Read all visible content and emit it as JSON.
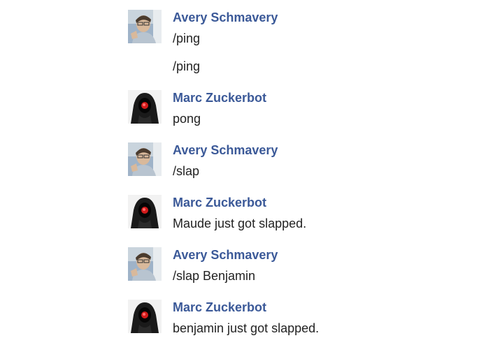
{
  "colors": {
    "sender_name": "#3b5998",
    "message_text": "#222222",
    "background": "#ffffff"
  },
  "messages": [
    {
      "sender": "Avery Schmavery",
      "avatar_icon": "avery-photo-avatar",
      "lines": [
        "/ping",
        "/ping"
      ]
    },
    {
      "sender": "Marc Zuckerbot",
      "avatar_icon": "hooded-robot-avatar",
      "lines": [
        "pong"
      ]
    },
    {
      "sender": "Avery Schmavery",
      "avatar_icon": "avery-photo-avatar",
      "lines": [
        "/slap"
      ]
    },
    {
      "sender": "Marc Zuckerbot",
      "avatar_icon": "hooded-robot-avatar",
      "lines": [
        "Maude just got slapped."
      ]
    },
    {
      "sender": "Avery Schmavery",
      "avatar_icon": "avery-photo-avatar",
      "lines": [
        "/slap Benjamin"
      ]
    },
    {
      "sender": "Marc Zuckerbot",
      "avatar_icon": "hooded-robot-avatar",
      "lines": [
        "benjamin just got slapped."
      ]
    }
  ]
}
